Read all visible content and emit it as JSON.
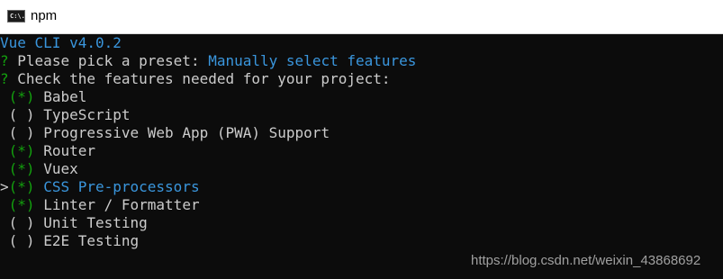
{
  "window": {
    "title": "npm",
    "icon_text": "C:\\."
  },
  "terminal": {
    "version_line": "Vue CLI v4.0.2",
    "preset_prompt": {
      "mark": "?",
      "label": "Please pick a preset:",
      "value": "Manually select features"
    },
    "features_prompt": {
      "mark": "?",
      "label": "Check the features needed for your project:"
    },
    "pointer": ">",
    "features": [
      {
        "box": "(*)",
        "label": "Babel",
        "checked": true
      },
      {
        "box": "( )",
        "label": "TypeScript",
        "checked": false
      },
      {
        "box": "( )",
        "label": "Progressive Web App (PWA) Support",
        "checked": false
      },
      {
        "box": "(*)",
        "label": "Router",
        "checked": true
      },
      {
        "box": "(*)",
        "label": "Vuex",
        "checked": true
      },
      {
        "box": "(*)",
        "label": "CSS Pre-processors",
        "checked": true
      },
      {
        "box": "(*)",
        "label": "Linter / Formatter",
        "checked": true
      },
      {
        "box": "( )",
        "label": "Unit Testing",
        "checked": false
      },
      {
        "box": "( )",
        "label": "E2E Testing",
        "checked": false
      }
    ]
  },
  "watermark": "https://blog.csdn.net/weixin_43868692",
  "colors": {
    "prompt_green": "#13a10e",
    "highlight_blue": "#3a96dd",
    "text": "#cccccc",
    "background": "#0c0c0c"
  }
}
